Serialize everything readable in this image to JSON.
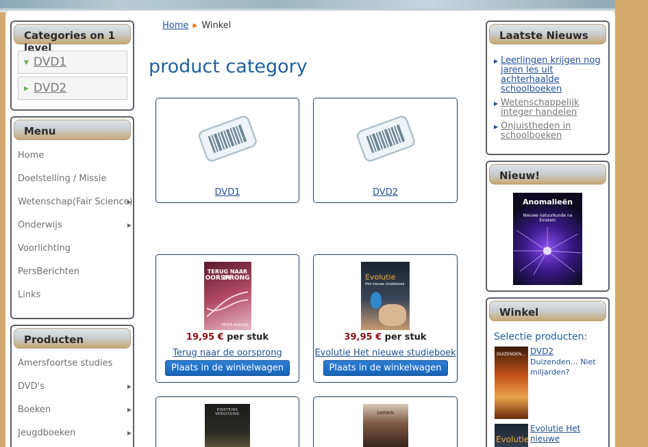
{
  "categories_box": {
    "title": "Categories on 1 level",
    "items": [
      {
        "label": "DVD1"
      },
      {
        "label": "DVD2"
      }
    ]
  },
  "menu_box": {
    "title": "Menu",
    "items": [
      {
        "label": "Home"
      },
      {
        "label": "Doelstelling / Missie"
      },
      {
        "label": "Wetenschap(Fair Science)"
      },
      {
        "label": "Onderwijs"
      },
      {
        "label": "Voorlichting"
      },
      {
        "label": "PersBerichten"
      },
      {
        "label": "Links"
      }
    ]
  },
  "producten_box": {
    "title": "Producten",
    "items": [
      {
        "label": "Amersfoortse studies"
      },
      {
        "label": "DVD's"
      },
      {
        "label": "Boeken"
      },
      {
        "label": "Jeugdboeken"
      }
    ]
  },
  "breadcrumb": {
    "home": "Home",
    "current": "Winkel"
  },
  "page_title": "product category",
  "category_cards": [
    {
      "label": "DVD1"
    },
    {
      "label": "DVD2"
    }
  ],
  "product_cards": [
    {
      "book_title_1": "TERUG NAAR DE",
      "book_title_2": "OORSPRONG",
      "book_author": "PETER BORGER",
      "price": "19,95 €",
      "unit": "per stuk",
      "name": "Terug naar de oorsprong",
      "button": "Plaats in de winkelwagen"
    },
    {
      "book_title_1": "Evolutie",
      "book_title_2": "Het nieuwe studieboek",
      "price": "39,95 €",
      "unit": "per stuk",
      "name": "Evolutie Het nieuwe studieboek",
      "button": "Plaats in de winkelwagen"
    }
  ],
  "bottom_cards": [
    {
      "book_title": "EINSTEINS VERGISSING"
    },
    {
      "book_title": "DARWIN"
    }
  ],
  "news_box": {
    "title": "Laatste Nieuws",
    "items": [
      {
        "label": "Leerlingen krijgen nog jaren les uit achterhaalde schoolboeken"
      },
      {
        "label": "Wetenschappelijk integer handelen"
      },
      {
        "label": "Onjuistheden in schoolboeken"
      }
    ]
  },
  "new_box": {
    "title": "Nieuw!",
    "book_title": "Anomalieën",
    "book_subtitle": "Nieuwe natuurkunde na Einstein"
  },
  "shop_box": {
    "title": "Winkel",
    "selection_label": "Selectie producten:",
    "items": [
      {
        "category": "DVD2",
        "name": "Duizenden… Niet miljarden?",
        "cover_text": "DUIZENDEN..."
      },
      {
        "category": "Evolutie Het nieuwe",
        "name": "",
        "cover_text": "Evolutie"
      }
    ]
  }
}
